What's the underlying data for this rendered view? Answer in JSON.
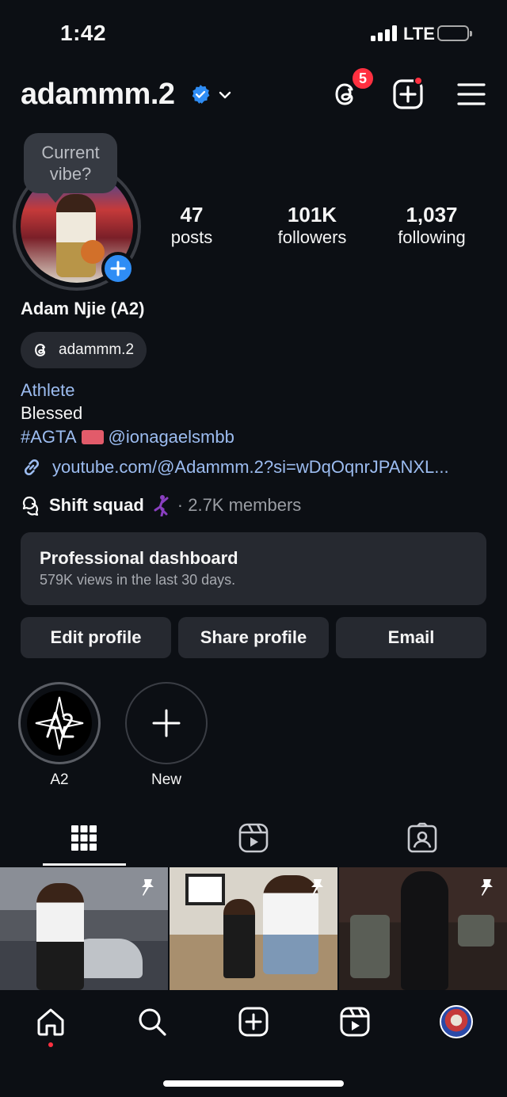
{
  "status_bar": {
    "time": "1:42",
    "network": "LTE"
  },
  "header": {
    "username": "adammm.2",
    "threads_badge_count": "5"
  },
  "avatar_tooltip": "Current vibe?",
  "stats": [
    {
      "num": "47",
      "label": "posts"
    },
    {
      "num": "101K",
      "label": "followers"
    },
    {
      "num": "1,037",
      "label": "following"
    }
  ],
  "profile": {
    "full_name": "Adam Njie (A2)",
    "threads_handle": "adammm.2",
    "category": "Athlete",
    "bio_line1": "Blessed",
    "bio_hashtag": "#AGTA",
    "bio_mention": "@ionagaelsmbb",
    "link": "youtube.com/@Adammm.2?si=wDqOqnrJPANXL...",
    "channel_name": "Shift squad",
    "channel_meta": "· 2.7K members"
  },
  "dashboard": {
    "title": "Professional dashboard",
    "subtitle": "579K views in the last 30 days."
  },
  "buttons": {
    "edit": "Edit profile",
    "share": "Share profile",
    "email": "Email"
  },
  "highlights": [
    {
      "label": "A2"
    },
    {
      "label": "New"
    }
  ],
  "colors": {
    "accent_blue": "#2f8df5",
    "link_blue": "#9cbcf0",
    "badge_red": "#ff3040",
    "surface": "#262930",
    "background": "#0c0f14"
  }
}
